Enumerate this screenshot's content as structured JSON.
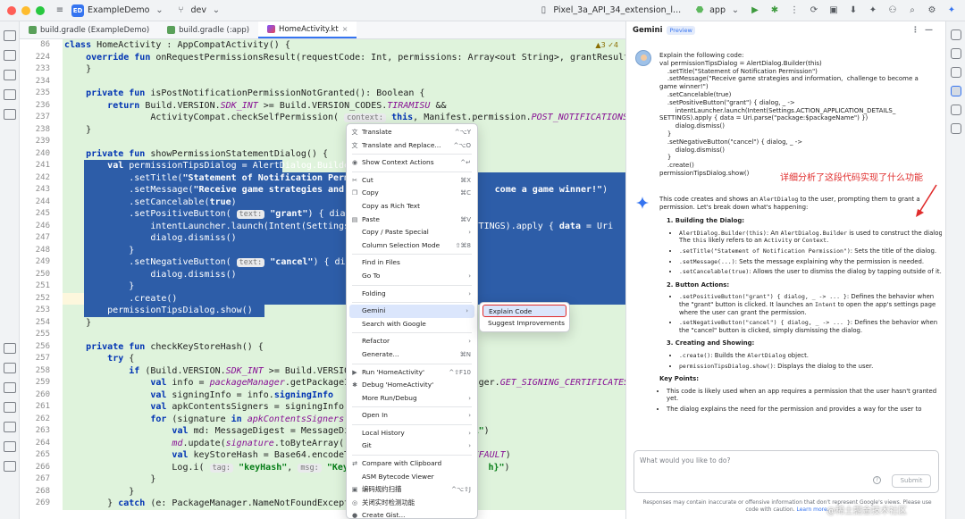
{
  "titlebar": {
    "project_badge": "ED",
    "project": "ExampleDemo",
    "vcs_branch": "dev",
    "device": "Pixel_3a_API_34_extension_l...",
    "run_config": "app"
  },
  "tabs": [
    {
      "label": "build.gradle (ExampleDemo)",
      "type": "gradle",
      "active": false
    },
    {
      "label": "build.gradle (:app)",
      "type": "gradle",
      "active": false
    },
    {
      "label": "HomeActivity.kt",
      "type": "kotlin",
      "active": true
    }
  ],
  "editor": {
    "warnings": "▲3 ✓4",
    "lines": [
      {
        "n": "86",
        "html": "<span class='kw'>class</span> HomeActivity : AppCompatActivity() {"
      },
      {
        "n": "224",
        "html": "    <span class='kw'>override fun</span> onRequestPermissionsResult(requestCode: Int, permissions: Array&lt;out String&gt;, grantResults: Int"
      },
      {
        "n": "233",
        "html": "    }"
      },
      {
        "n": "234",
        "html": ""
      },
      {
        "n": "235",
        "html": "    <span class='kw'>private fun</span> isPostNotificationPermissionNotGranted(): Boolean {"
      },
      {
        "n": "236",
        "html": "        <span class='kw'>return</span> Build.VERSION.<span class='it'>SDK_INT</span> &gt;= Build.VERSION_CODES.<span class='it'>TIRAMISU</span> &amp;&amp;"
      },
      {
        "n": "237",
        "html": "                ActivityCompat.checkSelfPermission( <span class='hint'>context:</span> <span class='kw'>this</span>, Manifest.permission.<span class='it'>POST_NOTIFICATIONS</span>) != Pa"
      },
      {
        "n": "238",
        "html": "    }"
      },
      {
        "n": "239",
        "html": ""
      },
      {
        "n": "240",
        "html": "    <span class='kw'>private fun</span> showPermissionStatementDialog() {"
      },
      {
        "n": "241",
        "html": "        <span class='kw'>val</span> permissionTipsDialog = AlertDialog.Builder(",
        "sel": [
          48,
          270
        ]
      },
      {
        "n": "242",
        "html": "            .setTitle(<span class='str'>\"Statement of Notification Permis</span>",
        "sel": [
          48,
          700
        ]
      },
      {
        "n": "243",
        "html": "            .setMessage(<span class='str'>\"Receive game strategies and in                         come a game winner!\"</span>)",
        "sel": [
          48,
          700
        ]
      },
      {
        "n": "244",
        "html": "            .setCancelable(<span class='kw'>true</span>)",
        "sel": [
          48,
          700
        ]
      },
      {
        "n": "245",
        "html": "            .setPositiveButton( <span class='hint'>text:</span> <span class='str'>\"grant\"</span>) { dialog,",
        "sel": [
          48,
          700
        ]
      },
      {
        "n": "246",
        "html": "                intentLauncher.launch(Intent(Settings.A                  _SETTINGS).apply { <span class='kw'>data</span> = Uri",
        "sel": [
          48,
          700
        ]
      },
      {
        "n": "247",
        "html": "                dialog.dismiss()",
        "sel": [
          48,
          700
        ]
      },
      {
        "n": "248",
        "html": "            }",
        "sel": [
          48,
          700
        ]
      },
      {
        "n": "249",
        "html": "            .setNegativeButton( <span class='hint'>text:</span> <span class='str'>\"cancel\"</span>) { dialog,",
        "sel": [
          48,
          700
        ]
      },
      {
        "n": "250",
        "html": "                dialog.dismiss()",
        "sel": [
          48,
          700
        ]
      },
      {
        "n": "251",
        "html": "            }",
        "sel": [
          48,
          700
        ]
      },
      {
        "n": "252",
        "html": "            .create()",
        "sel": [
          48,
          700
        ],
        "cur": true
      },
      {
        "n": "253",
        "html": "        permissionTipsDialog.show()",
        "sel": [
          48,
          250
        ]
      },
      {
        "n": "254",
        "html": "    }"
      },
      {
        "n": "255",
        "html": ""
      },
      {
        "n": "256",
        "html": "    <span class='kw'>private fun</span> checkKeyStoreHash() {"
      },
      {
        "n": "257",
        "html": "        <span class='kw'>try</span> {"
      },
      {
        "n": "258",
        "html": "            <span class='kw'>if</span> (Build.VERSION.<span class='it'>SDK_INT</span> &gt;= Build.VERSION_"
      },
      {
        "n": "259",
        "html": "                <span class='kw'>val</span> info = <span class='it'>packageManager</span>.getPackageInf                    nager.<span class='it'>GET_SIGNING_CERTIFICATES</span>"
      },
      {
        "n": "260",
        "html": "                <span class='kw'>val</span> signingInfo = info.<span class='kw'>signingInfo</span>"
      },
      {
        "n": "261",
        "html": "                <span class='kw'>val</span> apkContentsSigners = signingInfo.a"
      },
      {
        "n": "262",
        "html": "                <span class='kw'>for</span> (signature <span class='kw'>in</span> <span class='it'>apkContentsSigners</span>) {"
      },
      {
        "n": "263",
        "html": "                    <span class='kw'>val</span> md: MessageDigest = MessageDig                     <span class='str'>HA\"</span>)"
      },
      {
        "n": "264",
        "html": "                    <span class='it'>md</span>.update(<span class='it'>signature</span>.toByteArray())"
      },
      {
        "n": "265",
        "html": "                    <span class='kw'>val</span> keyStoreHash = Base64.encodeTo                     <span class='it'>DEFAULT</span>)"
      },
      {
        "n": "266",
        "html": "                    Log.i( <span class='hint'>tag:</span> <span class='str'>\"keyHash\"</span>, <span class='hint'>msg:</span> <span class='str'>\"KeyHash</span>                      <span class='str'>h}\"</span>)"
      },
      {
        "n": "267",
        "html": "                }"
      },
      {
        "n": "268",
        "html": "            }"
      },
      {
        "n": "269",
        "html": "        } <span class='kw'>catch</span> (e: PackageManager.NameNotFoundExcepti"
      }
    ]
  },
  "context_menu": {
    "items": [
      {
        "label": "Translate",
        "icon": "translate-icon",
        "glyph": "文",
        "shortcut": "^⌥Y"
      },
      {
        "label": "Translate and Replace...",
        "icon": "translate-replace-icon",
        "glyph": "文",
        "shortcut": "^⌥O"
      },
      {
        "sep": true
      },
      {
        "label": "Show Context Actions",
        "icon": "bulb-icon",
        "glyph": "◉",
        "shortcut": "^↵"
      },
      {
        "sep": true
      },
      {
        "label": "Cut",
        "icon": "cut-icon",
        "glyph": "✂",
        "shortcut": "⌘X"
      },
      {
        "label": "Copy",
        "icon": "copy-icon",
        "glyph": "❐",
        "shortcut": "⌘C"
      },
      {
        "label": "Copy as Rich Text",
        "icon": "",
        "glyph": "",
        "shortcut": ""
      },
      {
        "label": "Paste",
        "icon": "paste-icon",
        "glyph": "▤",
        "shortcut": "⌘V"
      },
      {
        "label": "Copy / Paste Special",
        "icon": "",
        "glyph": "",
        "shortcut": "›"
      },
      {
        "label": "Column Selection Mode",
        "icon": "",
        "glyph": "",
        "shortcut": "⇧⌘8"
      },
      {
        "sep": true
      },
      {
        "label": "Find in Files",
        "icon": "",
        "glyph": "",
        "shortcut": ""
      },
      {
        "label": "Go To",
        "icon": "",
        "glyph": "",
        "shortcut": "›"
      },
      {
        "sep": true
      },
      {
        "label": "Folding",
        "icon": "",
        "glyph": "",
        "shortcut": "›"
      },
      {
        "sep": true
      },
      {
        "label": "Gemini",
        "icon": "",
        "glyph": "",
        "shortcut": "›",
        "highlight": true
      },
      {
        "label": "Search with Google",
        "icon": "",
        "glyph": "",
        "shortcut": ""
      },
      {
        "sep": true
      },
      {
        "label": "Refactor",
        "icon": "",
        "glyph": "",
        "shortcut": "›"
      },
      {
        "label": "Generate...",
        "icon": "",
        "glyph": "",
        "shortcut": "⌘N"
      },
      {
        "sep": true
      },
      {
        "label": "Run 'HomeActivity'",
        "icon": "run-icon",
        "glyph": "▶",
        "shortcut": "^⇧F10"
      },
      {
        "label": "Debug 'HomeActivity'",
        "icon": "debug-icon",
        "glyph": "✱",
        "shortcut": ""
      },
      {
        "label": "More Run/Debug",
        "icon": "",
        "glyph": "",
        "shortcut": "›"
      },
      {
        "sep": true
      },
      {
        "label": "Open In",
        "icon": "",
        "glyph": "",
        "shortcut": "›"
      },
      {
        "sep": true
      },
      {
        "label": "Local History",
        "icon": "",
        "glyph": "",
        "shortcut": "›"
      },
      {
        "label": "Git",
        "icon": "",
        "glyph": "",
        "shortcut": "›"
      },
      {
        "sep": true
      },
      {
        "label": "Compare with Clipboard",
        "icon": "compare-icon",
        "glyph": "⇄",
        "shortcut": ""
      },
      {
        "label": "ASM Bytecode Viewer",
        "icon": "",
        "glyph": "",
        "shortcut": ""
      },
      {
        "label": "编码规约扫描",
        "icon": "scan-icon",
        "glyph": "▣",
        "shortcut": "^⌥⇧J"
      },
      {
        "label": "关闭实时检测功能",
        "icon": "realtime-icon",
        "glyph": "◎",
        "shortcut": ""
      },
      {
        "label": "Create Gist...",
        "icon": "github-icon",
        "glyph": "●",
        "shortcut": ""
      }
    ]
  },
  "submenu": {
    "explain": "Explain Code",
    "suggest": "Suggest Improvements"
  },
  "panel": {
    "title": "Gemini",
    "preview_badge": "Preview",
    "prompt": "Explain the following code:\nval permissionTipsDialog = AlertDialog.Builder(this)\n    .setTitle(\"Statement of Notification Permission\")\n    .setMessage(\"Receive game strategies and information,  challenge to become a\ngame winner!\")\n    .setCancelable(true)\n    .setPositiveButton(\"grant\") { dialog, _ ->\n        intentLauncher.launch(Intent(Settings.ACTION_APPLICATION_DETAILS_\nSETTINGS).apply { data = Uri.parse(\"package:$packageName\") })\n        dialog.dismiss()\n    }\n    .setNegativeButton(\"cancel\") { dialog, _ ->\n        dialog.dismiss()\n    }\n    .create()\npermissionTipsDialog.show()",
    "annotation": "详细分析了这段代码实现了什么功能",
    "input_placeholder": "What would you like to do?",
    "help_glyph": "?",
    "submit": "Submit",
    "disclaimer_text": "Responses may contain inaccurate or offensive information that don't represent Google's views. Please use code with caution.",
    "learn_more": "Learn more."
  },
  "answer": {
    "intro_pre": "This code creates and shows an ",
    "intro_code": "AlertDialog",
    "intro_post": " to the user, prompting them to grant a permission. Let's break down what's happening:",
    "s1_title": "1. Building the Dialog:",
    "s1_items": [
      [
        "AlertDialog.Builder(this)",
        ": An ",
        "AlertDialog.Builder",
        " is used to construct the dialog. The ",
        "this",
        " likely refers to an ",
        "Activity",
        " or ",
        "Context",
        "."
      ],
      [
        ".setTitle(\"Statement of Notification Permission\")",
        ": Sets the title of the dialog."
      ],
      [
        ".setMessage(...)",
        ": Sets the message explaining why the permission is needed."
      ],
      [
        ".setCancelable(true)",
        ": Allows the user to dismiss the dialog by tapping outside of it."
      ]
    ],
    "s2_title": "2. Button Actions:",
    "s2_items": [
      [
        ".setPositiveButton(\"grant\") { dialog, _ -> ... }",
        ": Defines the behavior when the \"grant\" button is clicked. It launches an ",
        "Intent",
        " to open the app's settings page where the user can grant the permission."
      ],
      [
        ".setNegativeButton(\"cancel\") { dialog, _ -> ... }",
        ": Defines the behavior when the \"cancel\" button is clicked, simply dismissing the dialog."
      ]
    ],
    "s3_title": "3. Creating and Showing:",
    "s3_items": [
      [
        ".create()",
        ": Builds the ",
        "AlertDialog",
        " object."
      ],
      [
        "permissionTipsDialog.show()",
        ": Displays the dialog to the user."
      ]
    ],
    "kp_title": "Key Points:",
    "kp_items": [
      "This code is likely used when an app requires a permission that the user hasn't granted yet.",
      "The dialog explains the need for the permission and provides a way for the user to"
    ]
  },
  "watermark": "@稀土掘金技术社区",
  "colors": {
    "accent": "#3574f0",
    "selection": "#2d5da8",
    "editor_bg": "#dff3dc",
    "annotation": "#e02c2c"
  }
}
